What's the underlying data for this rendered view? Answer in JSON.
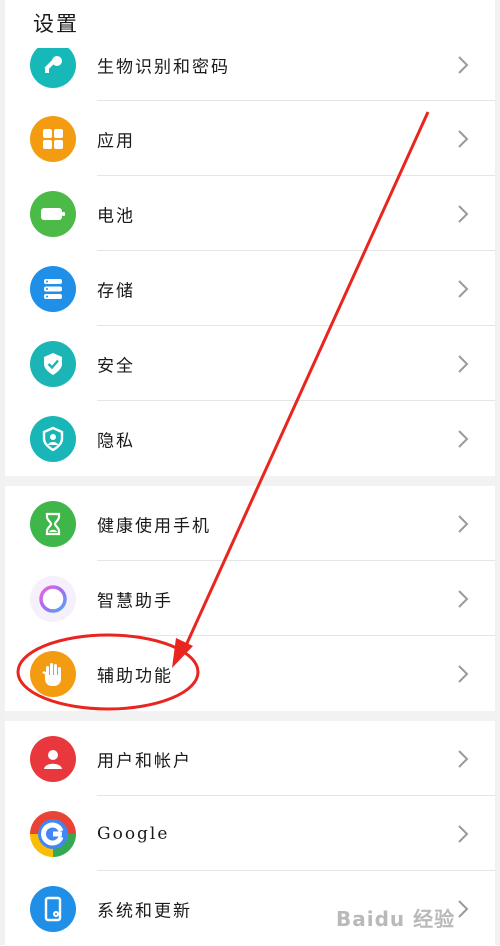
{
  "header": {
    "title": "设置"
  },
  "groups": [
    {
      "items": [
        {
          "key": "biometrics",
          "label": "生物识别和密码",
          "icon": "key-icon",
          "color": "#17b9b8"
        },
        {
          "key": "apps",
          "label": "应用",
          "icon": "apps-grid-icon",
          "color": "#f39c12"
        },
        {
          "key": "battery",
          "label": "电池",
          "icon": "battery-icon",
          "color": "#4cba47"
        },
        {
          "key": "storage",
          "label": "存储",
          "icon": "storage-icon",
          "color": "#1f8fe8"
        },
        {
          "key": "security",
          "label": "安全",
          "icon": "shield-check-icon",
          "color": "#1bb5b5"
        },
        {
          "key": "privacy",
          "label": "隐私",
          "icon": "privacy-icon",
          "color": "#18b6b6"
        }
      ]
    },
    {
      "items": [
        {
          "key": "wellbeing",
          "label": "健康使用手机",
          "icon": "hourglass-icon",
          "color": "#3fb64a"
        },
        {
          "key": "assistant",
          "label": "智慧助手",
          "icon": "assistant-ring-icon",
          "color": "#f5f0fb"
        },
        {
          "key": "accessibility",
          "label": "辅助功能",
          "icon": "hand-icon",
          "color": "#f39c12"
        }
      ]
    },
    {
      "items": [
        {
          "key": "users",
          "label": "用户和帐户",
          "icon": "user-icon",
          "color": "#e8383d"
        },
        {
          "key": "google",
          "label": "Google",
          "icon": "google-icon",
          "color": "#ffffff"
        },
        {
          "key": "system",
          "label": "系统和更新",
          "icon": "phone-settings-icon",
          "color": "#1f8fe8"
        }
      ]
    }
  ],
  "annotation": {
    "color": "#e8251f"
  },
  "watermark": {
    "text": "Baidu 经验"
  }
}
